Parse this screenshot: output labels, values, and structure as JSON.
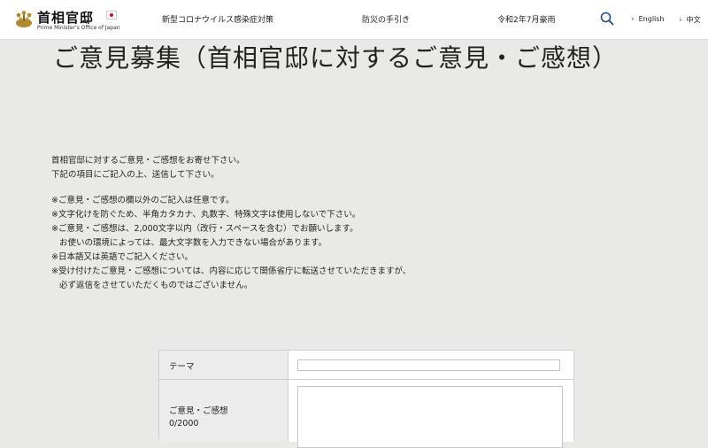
{
  "header": {
    "logo_title": "首相官邸",
    "logo_subtitle": "Prime Minister's Office of Japan",
    "nav": [
      {
        "label": "新型コロナウイルス感染症対策"
      },
      {
        "label": "防災の手引き"
      },
      {
        "label": "令和2年7月豪雨"
      }
    ],
    "search_icon": "search-icon",
    "languages": [
      {
        "label": "English"
      },
      {
        "label": "中文"
      }
    ]
  },
  "page": {
    "title": "ご意見募集（首相官邸に対するご意見・ご感想）"
  },
  "intro": [
    "首相官邸に対するご意見・ご感想をお寄せ下さい。",
    "下記の項目にご記入の上、送信して下さい。"
  ],
  "notes": [
    "※ご意見・ご感想の欄以外のご記入は任意です。",
    "※文字化けを防ぐため、半角カタカナ、丸数字、特殊文字は使用しないで下さい。",
    "※ご意見・ご感想は、2,000文字以内（改行・スペースを含む）でお願いします。",
    "お使いの環境によっては、最大文字数を入力できない場合があります。",
    "※日本語又は英語でご記入ください。",
    "※受け付けたご意見・ご感想については、内容に応じて関係省庁に転送させていただきますが、",
    "必ず返信をさせていただくものではございません。"
  ],
  "form": {
    "theme_label": "テーマ",
    "theme_value": "",
    "opinion_label": "ご意見・ご感想",
    "char_count": "0/2000",
    "opinion_value": ""
  },
  "colors": {
    "background": "#e9eae7",
    "header_bg": "#ffffff",
    "flag_red": "#c8102e",
    "emblem_gold": "#b08a2e"
  }
}
